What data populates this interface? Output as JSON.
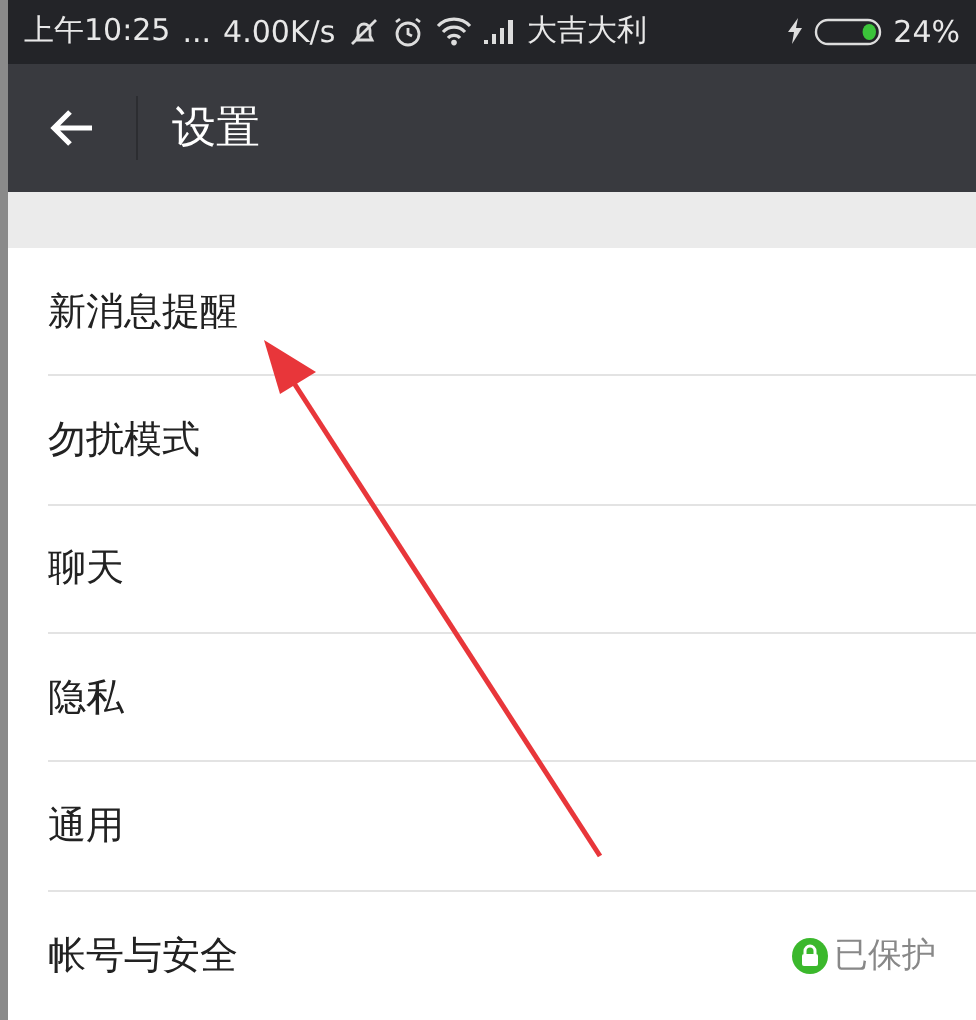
{
  "status_bar": {
    "time": "上午10:25",
    "dots": "...",
    "speed": "4.00K/s",
    "carrier": "大吉大利",
    "battery": {
      "level": 0.24,
      "charging": true
    },
    "battery_text": "24%"
  },
  "header": {
    "title": "设置"
  },
  "items": [
    {
      "label": "新消息提醒"
    },
    {
      "label": "勿扰模式"
    },
    {
      "label": "聊天"
    },
    {
      "label": "隐私"
    },
    {
      "label": "通用"
    },
    {
      "label": "帐号与安全",
      "status": "已保护"
    }
  ]
}
